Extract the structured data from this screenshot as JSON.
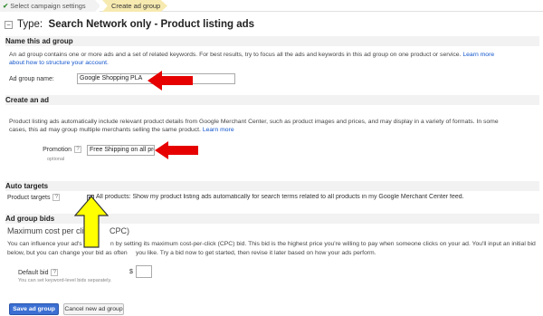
{
  "breadcrumb": {
    "step1": "Select campaign settings",
    "step2": "Create ad group"
  },
  "page_title": {
    "prefix": "Type:",
    "value": "Search Network only - Product listing ads"
  },
  "name_section": {
    "heading": "Name this ad group",
    "description": "An ad group contains one or more ads and a set of related keywords. For best results, try to focus all the ads and keywords in this ad group on one product or service.",
    "learn_more_1": "Learn more",
    "learn_more_2": "about how to structure your account.",
    "field_label": "Ad group name:",
    "field_value": "Google Shopping PLA"
  },
  "ad_section": {
    "heading": "Create an ad",
    "description_1": "Product listing ads automatically include relevant product details from Google Merchant Center, such as product images and prices, and may display in a variety of formats. In some",
    "description_2": "cases, this ad may group multiple merchants selling the same product.",
    "learn_more": "Learn more",
    "promotion_label": "Promotion",
    "promotion_help": "?",
    "promotion_optional": "optional",
    "promotion_value": "Free Shipping on all pro"
  },
  "targets_section": {
    "heading": "Auto targets",
    "label": "Product targets",
    "help": "?",
    "checkbox_checked": true,
    "checkbox_text": "All products: Show my product listing ads automatically for search terms related to all products in my Google Merchant Center feed."
  },
  "bids_section": {
    "heading": "Ad group bids",
    "subheading_a": "Maximum cost per click",
    "subheading_b": "CPC)",
    "description_1a": "You can influence your ad's",
    "description_1b": "n by setting its maximum cost-per-click (CPC) bid. This bid is the highest price you're willing to pay when someone clicks on your ad. You'll input an initial bid",
    "description_2a": "below, but you can change your bid as often",
    "description_2b": "you like. Try a bid now to get started, then revise it later based on how your ads perform.",
    "default_bid_label": "Default bid",
    "default_bid_help": "?",
    "default_bid_note": "You can set keyword-level bids separately.",
    "currency": "$",
    "default_bid_value": ""
  },
  "buttons": {
    "save": "Save ad group",
    "cancel": "Cancel new ad group"
  },
  "colors": {
    "link": "#1155cc",
    "save_button": "#3b6fd2",
    "red_arrow": "#e60000",
    "yellow_arrow": "#ffff00",
    "breadcrumb_active": "#f7eab0"
  },
  "icons": {
    "collapse": "minus-box-icon",
    "check": "check-icon",
    "help": "question-box-icon"
  }
}
